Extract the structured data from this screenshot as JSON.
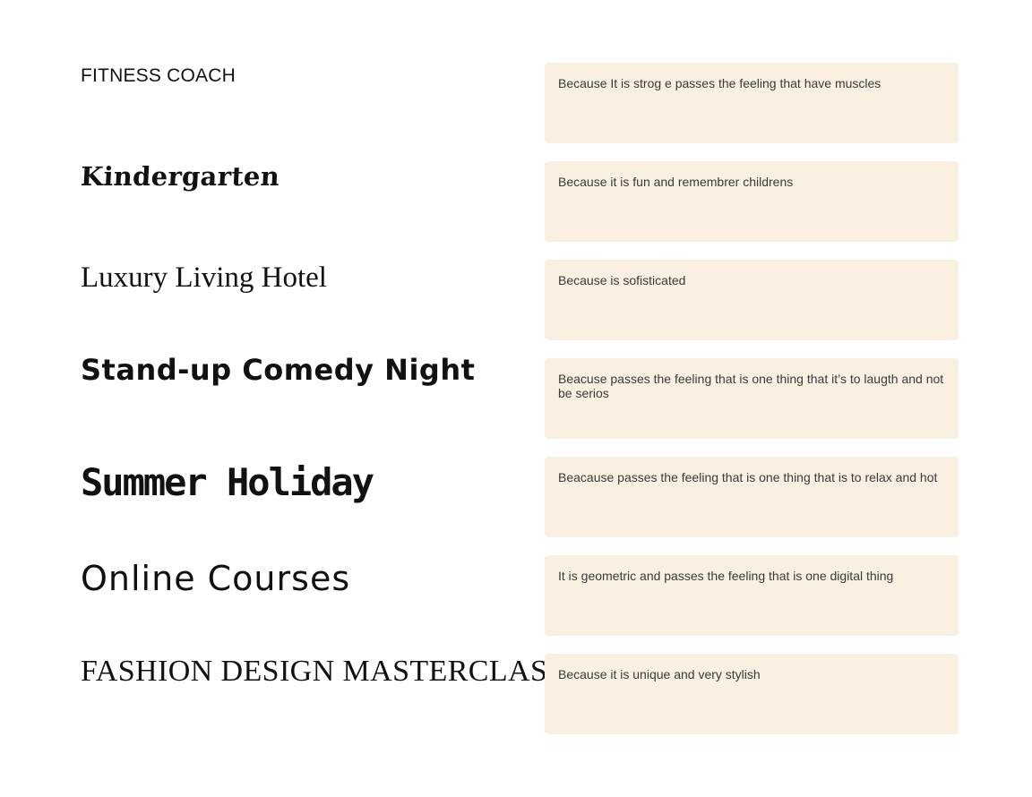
{
  "rows": [
    {
      "title": "FITNESS COACH",
      "note": "Because It is strog e passes the feeling that have muscles"
    },
    {
      "title": "Kindergarten",
      "note": "Because it is fun and remembrer childrens"
    },
    {
      "title": "Luxury Living Hotel",
      "note": "Because is sofisticated"
    },
    {
      "title": "Stand-up Comedy Night",
      "note": "Beacuse passes the feeling that is one thing that it’s to laugth and not be serios"
    },
    {
      "title": "Summer Holiday",
      "note": "Beacause passes the feeling that is one thing that is to relax and hot"
    },
    {
      "title": "Online Courses",
      "note": "It is geometric and passes the feeling that is one digital thing"
    },
    {
      "title": "FASHION DESIGN MASTERCLASS",
      "note": "Because it is unique and very stylish"
    }
  ],
  "colors": {
    "note_background": "#f9f0e2",
    "title_text": "#111111",
    "note_text": "#3a3a3a"
  }
}
